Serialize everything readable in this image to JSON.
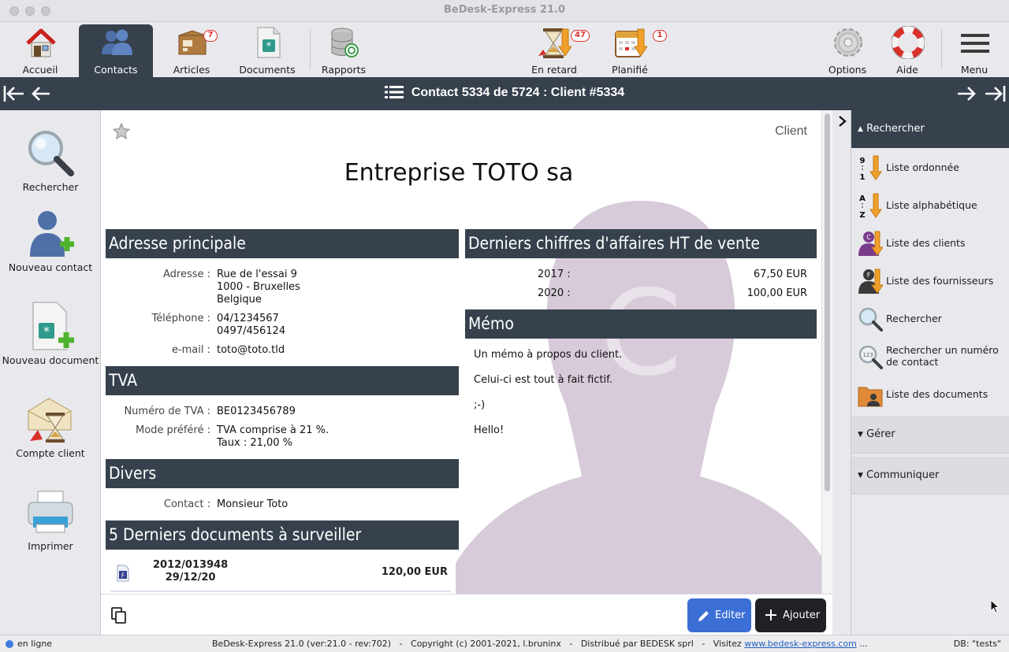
{
  "window": {
    "title": "BeDesk-Express 21.0"
  },
  "toolbar": {
    "items": [
      {
        "label": "Accueil",
        "icon": "house-icon"
      },
      {
        "label": "Contacts",
        "icon": "contacts-icon",
        "active": true
      },
      {
        "label": "Articles",
        "icon": "box-icon",
        "badge": "7"
      },
      {
        "label": "Documents",
        "icon": "document-icon"
      },
      {
        "label": "Rapports",
        "icon": "database-icon"
      },
      {
        "label": "En retard",
        "icon": "hourglass-icon",
        "badge": "47"
      },
      {
        "label": "Planifié",
        "icon": "calendar-icon",
        "badge": "1"
      },
      {
        "label": "Options",
        "icon": "gear-icon"
      },
      {
        "label": "Aide",
        "icon": "lifebuoy-icon"
      },
      {
        "label": "Menu",
        "icon": "hamburger-icon"
      }
    ]
  },
  "navbar": {
    "title": "Contact 5334 de 5724 : Client #5334"
  },
  "leftbar": {
    "items": [
      {
        "label": "Rechercher",
        "icon": "magnifier-icon"
      },
      {
        "label": "Nouveau contact",
        "icon": "add-person-icon"
      },
      {
        "label": "Nouveau document",
        "icon": "add-document-icon"
      },
      {
        "label": "Compte client",
        "icon": "account-icon"
      },
      {
        "label": "Imprimer",
        "icon": "printer-icon"
      }
    ]
  },
  "contact": {
    "type": "Client",
    "name": "Entreprise TOTO sa",
    "address": {
      "title": "Adresse principale",
      "address_label": "Adresse :",
      "address_value": "Rue de l'essai 9\n1000 - Bruxelles\nBelgique",
      "phone_label": "Téléphone :",
      "phone_value": "04/1234567\n0497/456124",
      "email_label": "e-mail :",
      "email_value": "toto@toto.tld"
    },
    "tva": {
      "title": "TVA",
      "number_label": "Numéro de TVA :",
      "number_value": "BE0123456789",
      "mode_label": "Mode préféré :",
      "mode_value": "TVA comprise à 21 %.\nTaux : 21,00 %"
    },
    "divers": {
      "title": "Divers",
      "contact_label": "Contact :",
      "contact_value": "Monsieur Toto"
    },
    "documents": {
      "title": "5 Derniers documents à surveiller",
      "rows": [
        {
          "number": "2012/013948",
          "date": "29/12/20",
          "amount": "120,00 EUR",
          "icon": "invoice-icon"
        }
      ]
    },
    "turnover": {
      "title": "Derniers chiffres d'affaires HT de vente",
      "rows": [
        {
          "year": "2017 :",
          "amount": "67,50 EUR"
        },
        {
          "year": "2020 :",
          "amount": "100,00 EUR"
        }
      ]
    },
    "memo": {
      "title": "Mémo",
      "lines": [
        "Un mémo à propos du client.",
        "Celui-ci est tout à fait fictif.",
        ";-)",
        "Hello!"
      ]
    }
  },
  "actions": {
    "edit_label": "Editer",
    "add_label": "Ajouter"
  },
  "rightbar": {
    "search_title": "Rechercher",
    "items": [
      {
        "label": "Liste ordonnée",
        "icon": "sort-numeric-icon"
      },
      {
        "label": "Liste alphabétique",
        "icon": "sort-alpha-icon"
      },
      {
        "label": "Liste des clients",
        "icon": "clients-list-icon"
      },
      {
        "label": "Liste des fournisseurs",
        "icon": "suppliers-list-icon"
      },
      {
        "label": "Rechercher",
        "icon": "magnifier-icon"
      },
      {
        "label": "Rechercher un numéro de contact",
        "icon": "search-number-icon"
      },
      {
        "label": "Liste des documents",
        "icon": "folder-icon"
      }
    ],
    "manage_title": "Gérer",
    "communicate_title": "Communiquer"
  },
  "status": {
    "online": "en ligne",
    "info_prefix": "BeDesk-Express 21.0 (ver:21.0 - rev:702)   -   Copyright (c) 2001-2021, l.bruninx   -   Distribué par BEDESK sprl   -   Visitez ",
    "link": "www.bedesk-express.com",
    "info_suffix": " ...",
    "db": "DB: \"tests\""
  },
  "colors": {
    "header_dark": "#36414d",
    "accent_blue": "#3b6fd6",
    "badge_red": "#d9302a"
  }
}
